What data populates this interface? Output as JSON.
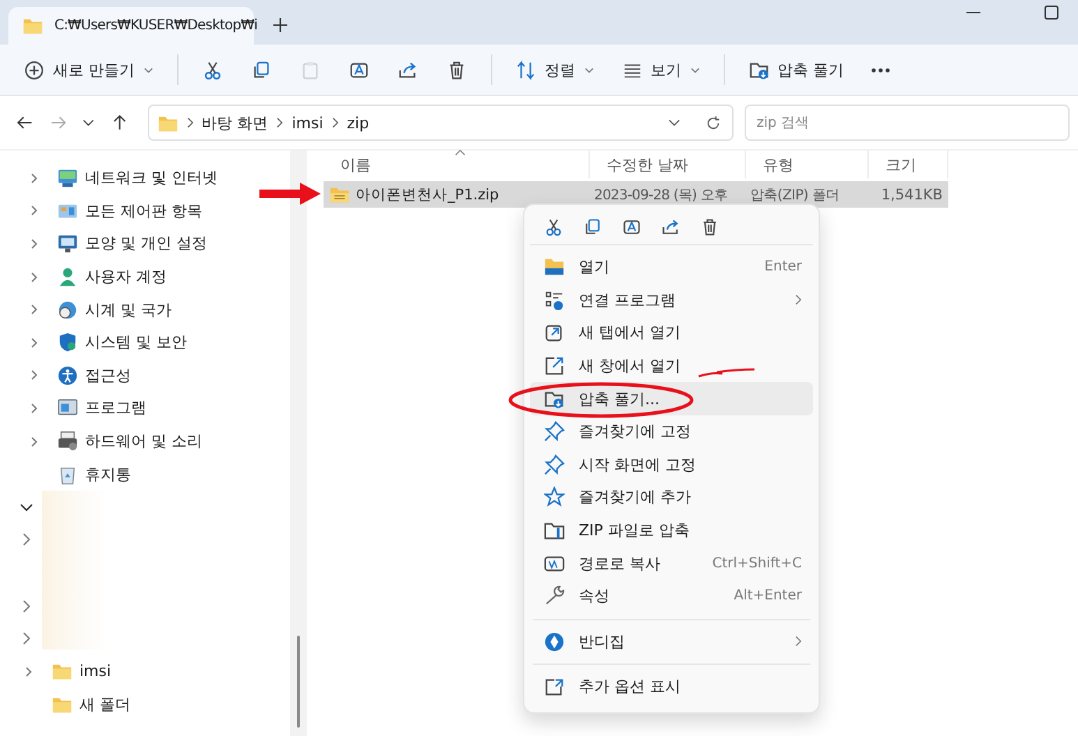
{
  "tab": {
    "title": "C:₩Users₩KUSER₩Desktop₩i",
    "selected": true
  },
  "toolbar": [
    {
      "kind": "new",
      "label": "새로 만들기",
      "disabled": false
    },
    {
      "kind": "cut",
      "disabled": false
    },
    {
      "kind": "copy",
      "disabled": false
    },
    {
      "kind": "paste",
      "disabled": true
    },
    {
      "kind": "rename",
      "disabled": false
    },
    {
      "kind": "share",
      "disabled": false
    },
    {
      "kind": "delete",
      "disabled": false
    },
    {
      "kind": "sort",
      "label": "정렬",
      "disabled": false
    },
    {
      "kind": "view",
      "label": "보기",
      "disabled": false
    },
    {
      "kind": "extract",
      "label": "압축 풀기",
      "disabled": false
    },
    {
      "kind": "more",
      "disabled": false
    }
  ],
  "address": {
    "crumbs": [
      "바탕 화면",
      "imsi",
      "zip"
    ],
    "search_placeholder": "zip 검색"
  },
  "sidebar": {
    "items": [
      {
        "kind": "network",
        "label": "네트워크 및 인터넷",
        "expandable": true
      },
      {
        "kind": "control",
        "label": "모든 제어판 항목",
        "expandable": true
      },
      {
        "kind": "appearance",
        "label": "모양 및 개인 설정",
        "expandable": true
      },
      {
        "kind": "user",
        "label": "사용자 계정",
        "expandable": true
      },
      {
        "kind": "clock",
        "label": "시계 및 국가",
        "expandable": true
      },
      {
        "kind": "security",
        "label": "시스템 및 보안",
        "expandable": true
      },
      {
        "kind": "access",
        "label": "접근성",
        "expandable": true
      },
      {
        "kind": "program",
        "label": "프로그램",
        "expandable": true
      },
      {
        "kind": "hardware",
        "label": "하드웨어 및 소리",
        "expandable": true
      },
      {
        "kind": "recycle",
        "label": "휴지통",
        "expandable": false
      },
      {
        "kind": "redacted",
        "rows": [
          {
            "kind": "tree",
            "expanded": true
          },
          {
            "kind": "tree",
            "expanded": false
          },
          {
            "kind": "blank"
          },
          {
            "kind": "tree",
            "expanded": false
          },
          {
            "kind": "tree",
            "expanded": false
          }
        ]
      },
      {
        "kind": "folder",
        "label": "imsi",
        "expandable": true
      },
      {
        "kind": "folder",
        "label": "새 폴더",
        "expandable": false
      }
    ]
  },
  "table": {
    "columns": [
      "이름",
      "수정한 날짜",
      "유형",
      "크기"
    ],
    "rows": [
      {
        "name": "아이폰변천사_P1.zip",
        "date": "2023-09-28 (목) 오후",
        "type": "압축(ZIP) 폴더",
        "size": "1,541KB",
        "selected": true
      }
    ]
  },
  "context_menu": {
    "items": [
      {
        "kind": "item",
        "label": "열기",
        "shortcut": "Enter",
        "submenu": false,
        "selected": false
      },
      {
        "kind": "item",
        "label": "연결 프로그램",
        "submenu": true,
        "selected": false
      },
      {
        "kind": "item",
        "label": "새 탭에서 열기",
        "submenu": false,
        "selected": false
      },
      {
        "kind": "item",
        "label": "새 창에서 열기",
        "submenu": false,
        "selected": false
      },
      {
        "kind": "item",
        "label": "압축 풀기...",
        "submenu": false,
        "selected": true
      },
      {
        "kind": "item",
        "label": "즐겨찾기에 고정",
        "submenu": false,
        "selected": false
      },
      {
        "kind": "item",
        "label": "시작 화면에 고정",
        "submenu": false,
        "selected": false
      },
      {
        "kind": "item",
        "label": "즐겨찾기에 추가",
        "submenu": false,
        "selected": false
      },
      {
        "kind": "item",
        "label": "ZIP 파일로 압축",
        "submenu": false,
        "selected": false
      },
      {
        "kind": "item",
        "label": "경로로 복사",
        "shortcut": "Ctrl+Shift+C",
        "submenu": false,
        "selected": false
      },
      {
        "kind": "item",
        "label": "속성",
        "shortcut": "Alt+Enter",
        "submenu": false,
        "selected": false
      },
      {
        "kind": "separator"
      },
      {
        "kind": "item",
        "label": "반디집",
        "submenu": true,
        "selected": false
      },
      {
        "kind": "separator"
      },
      {
        "kind": "item",
        "label": "추가 옵션 표시",
        "submenu": false,
        "selected": false
      }
    ]
  }
}
